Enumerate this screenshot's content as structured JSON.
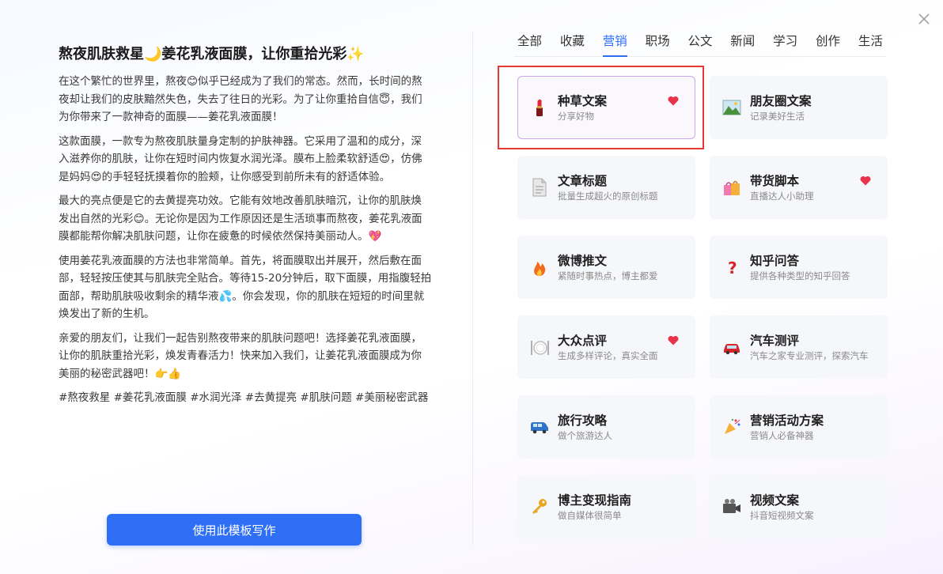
{
  "preview": {
    "title": "熬夜肌肤救星🌙姜花乳液面膜，让你重拾光彩✨",
    "paragraphs": [
      "在这个繁忙的世界里，熬夜😊似乎已经成为了我们的常态。然而，长时间的熬夜却让我们的皮肤黯然失色，失去了往日的光彩。为了让你重拾自信😇，我们为你带来了一款神奇的面膜——姜花乳液面膜！",
      "这款面膜，一款专为熬夜肌肤量身定制的护肤神器。它采用了温和的成分，深入滋养你的肌肤，让你在短时间内恢复水润光泽。膜布上脸柔软舒适😍，仿佛是妈妈😍的手轻轻抚摸着你的脸颊，让你感受到前所未有的舒适体验。",
      "最大的亮点便是它的去黄提亮功效。它能有效地改善肌肤暗沉，让你的肌肤焕发出自然的光彩😊。无论你是因为工作原因还是生活琐事而熬夜，姜花乳液面膜都能帮你解决肌肤问题，让你在疲惫的时候依然保持美丽动人。💖",
      "使用姜花乳液面膜的方法也非常简单。首先，将面膜取出并展开，然后敷在面部，轻轻按压使其与肌肤完全贴合。等待15-20分钟后，取下面膜，用指腹轻拍面部，帮助肌肤吸收剩余的精华液💦。你会发现，你的肌肤在短短的时间里就焕发出了新的生机。",
      "亲爱的朋友们，让我们一起告别熬夜带来的肌肤问题吧！选择姜花乳液面膜，让你的肌肤重拾光彩，焕发青春活力！快来加入我们，让姜花乳液面膜成为你美丽的秘密武器吧！👉👍",
      "#熬夜救星 #姜花乳液面膜 #水润光泽 #去黄提亮 #肌肤问题 #美丽秘密武器"
    ],
    "use_button": "使用此模板写作"
  },
  "tabs": [
    "全部",
    "收藏",
    "营销",
    "职场",
    "公文",
    "新闻",
    "学习",
    "创作",
    "生活"
  ],
  "active_tab": "营销",
  "cards": [
    {
      "title": "种草文案",
      "sub": "分享好物",
      "icon": "lipstick-icon",
      "fav": true,
      "selected": true
    },
    {
      "title": "朋友圈文案",
      "sub": "记录美好生活",
      "icon": "landscape-icon",
      "fav": false
    },
    {
      "title": "文章标题",
      "sub": "批量生成超火的原创标题",
      "icon": "document-icon",
      "fav": false
    },
    {
      "title": "带货脚本",
      "sub": "直播达人小助理",
      "icon": "shopping-bag-icon",
      "fav": true
    },
    {
      "title": "微博推文",
      "sub": "紧随时事热点，博主都爱",
      "icon": "fire-icon",
      "fav": false
    },
    {
      "title": "知乎问答",
      "sub": "提供各种类型的知乎回答",
      "icon": "question-icon",
      "fav": false
    },
    {
      "title": "大众点评",
      "sub": "生成多样评论，真实全面",
      "icon": "plate-icon",
      "fav": true
    },
    {
      "title": "汽车测评",
      "sub": "汽车之家专业测评，探索汽车",
      "icon": "car-icon",
      "fav": false
    },
    {
      "title": "旅行攻略",
      "sub": "做个旅游达人",
      "icon": "van-icon",
      "fav": false
    },
    {
      "title": "营销活动方案",
      "sub": "营销人必备神器",
      "icon": "party-icon",
      "fav": false
    },
    {
      "title": "博主变现指南",
      "sub": "做自媒体很简单",
      "icon": "key-icon",
      "fav": false
    },
    {
      "title": "视频文案",
      "sub": "抖音短视频文案",
      "icon": "camera-icon",
      "fav": false
    }
  ],
  "colors": {
    "accent": "#2f6ff5",
    "heart": "#e8334a",
    "highlight": "#e53935"
  }
}
